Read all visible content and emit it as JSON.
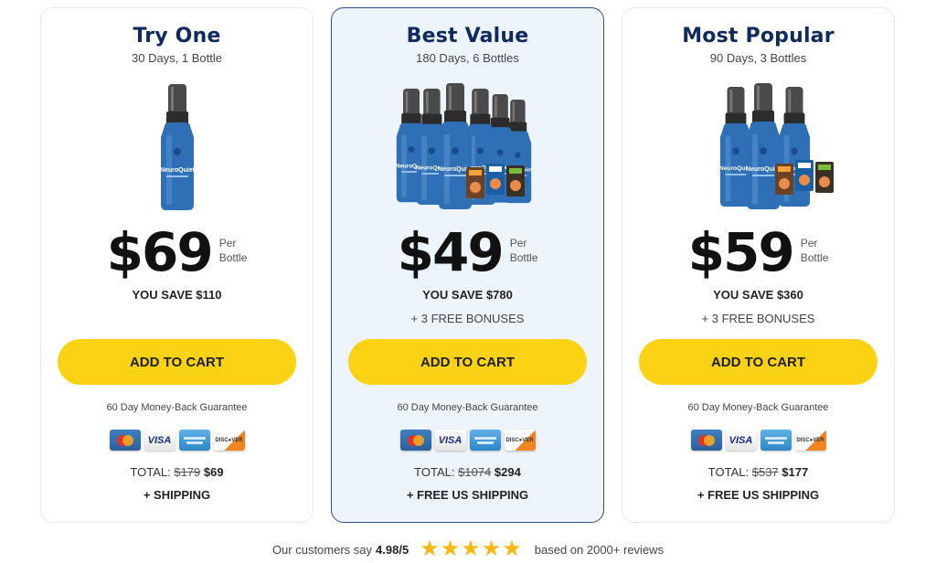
{
  "plans": [
    {
      "title": "Try One",
      "subtitle": "30 Days, 1 Bottle",
      "bottles": 1,
      "price": "$69",
      "per_line1": "Per",
      "per_line2": "Bottle",
      "you_save": "YOU SAVE $110",
      "bonuses": "",
      "cta": "ADD TO CART",
      "guarantee": "60 Day Money-Back Guarantee",
      "total_label": "TOTAL:",
      "total_old": "$179",
      "total_new": "$69",
      "shipping": "+ SHIPPING",
      "highlighted": false
    },
    {
      "title": "Best Value",
      "subtitle": "180 Days, 6 Bottles",
      "bottles": 6,
      "price": "$49",
      "per_line1": "Per",
      "per_line2": "Bottle",
      "you_save": "YOU SAVE $780",
      "bonuses": "+ 3 FREE BONUSES",
      "cta": "ADD TO CART",
      "guarantee": "60 Day Money-Back Guarantee",
      "total_label": "TOTAL:",
      "total_old": "$1074",
      "total_new": "$294",
      "shipping": "+ FREE US SHIPPING",
      "highlighted": true
    },
    {
      "title": "Most Popular",
      "subtitle": "90 Days, 3 Bottles",
      "bottles": 3,
      "price": "$59",
      "per_line1": "Per",
      "per_line2": "Bottle",
      "you_save": "YOU SAVE $360",
      "bonuses": "+ 3 FREE BONUSES",
      "cta": "ADD TO CART",
      "guarantee": "60 Day Money-Back Guarantee",
      "total_label": "TOTAL:",
      "total_old": "$537",
      "total_new": "$177",
      "shipping": "+ FREE US SHIPPING",
      "highlighted": false
    }
  ],
  "product_name": "NeuroQuiet",
  "payment_methods": [
    "MasterCard",
    "VISA",
    "American Express",
    "DISCOVER"
  ],
  "reviews": {
    "prefix": "Our customers say",
    "rating": "4.98/5",
    "stars": 5,
    "suffix": "based on 2000+ reviews"
  },
  "colors": {
    "title": "#0f2a5c",
    "cta": "#fbd214",
    "highlight_bg": "#edf4fc",
    "highlight_border": "#2f4f86",
    "star": "#f7b90f"
  }
}
